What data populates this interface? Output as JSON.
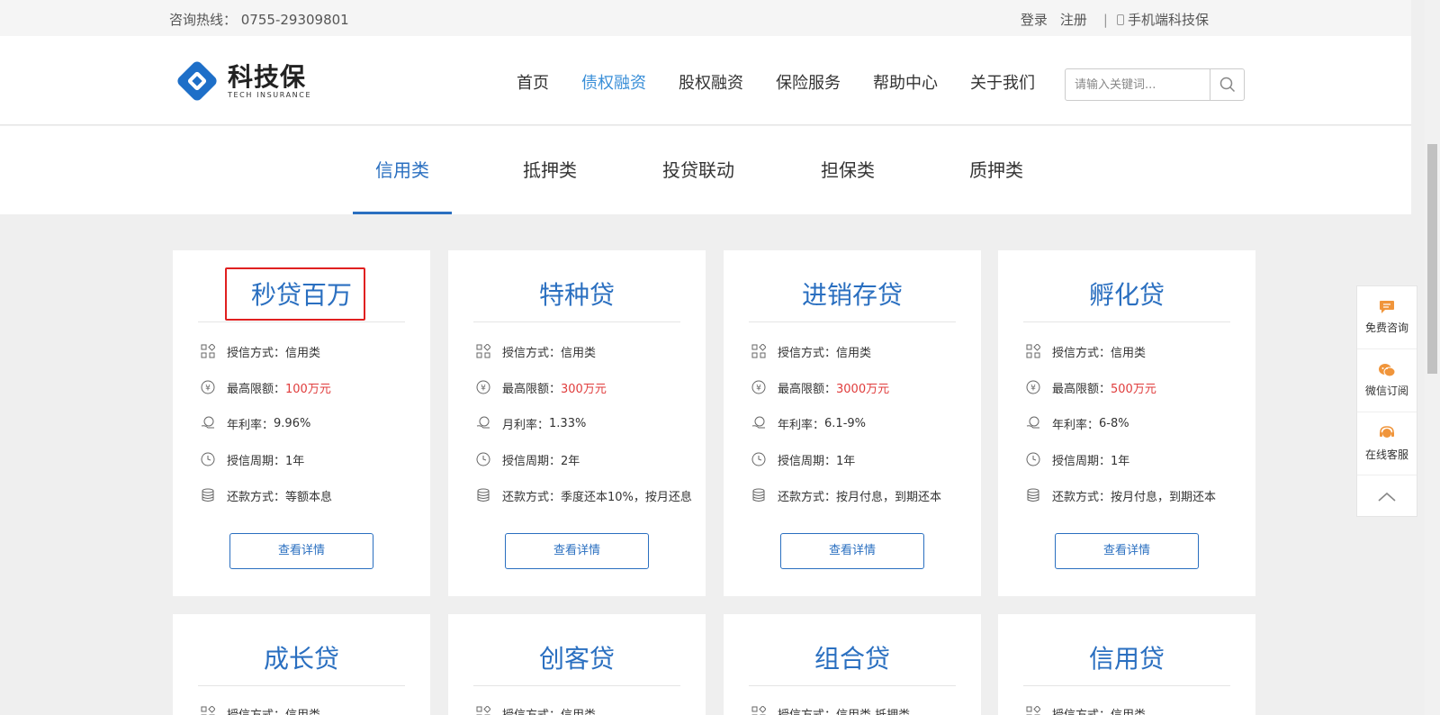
{
  "topbar": {
    "hotline": "咨询热线： 0755-29309801",
    "login": "登录",
    "register": "注册",
    "separator": "|",
    "mobile": "手机端科技保"
  },
  "logo": {
    "cn": "科技保",
    "en": "TECH INSURANCE"
  },
  "nav": {
    "items": [
      "首页",
      "债权融资",
      "股权融资",
      "保险服务",
      "帮助中心",
      "关于我们"
    ],
    "active": "债权融资"
  },
  "search": {
    "placeholder": "请输入关键词..."
  },
  "tabs": {
    "items": [
      "信用类",
      "抵押类",
      "投贷联动",
      "担保类",
      "质押类"
    ],
    "active": "信用类"
  },
  "labels": {
    "method": "授信方式：",
    "limit": "最高限额：",
    "period": "授信周期：",
    "repay": "还款方式：",
    "detail": "查看详情"
  },
  "products": [
    {
      "name": "秒贷百万",
      "method": "信用类",
      "limit": "100万元",
      "rate_label": "年利率：",
      "rate": "9.96%",
      "period": "1年",
      "repay": "等额本息"
    },
    {
      "name": "特种贷",
      "method": "信用类",
      "limit": "300万元",
      "rate_label": "月利率：",
      "rate": "1.33%",
      "period": "2年",
      "repay": "季度还本10%，按月还息"
    },
    {
      "name": "进销存贷",
      "method": "信用类",
      "limit": "3000万元",
      "rate_label": "年利率：",
      "rate": "6.1-9%",
      "period": "1年",
      "repay": "按月付息，到期还本"
    },
    {
      "name": "孵化贷",
      "method": "信用类",
      "limit": "500万元",
      "rate_label": "年利率：",
      "rate": "6-8%",
      "period": "1年",
      "repay": "按月付息，到期还本"
    },
    {
      "name": "成长贷",
      "method": "信用类"
    },
    {
      "name": "创客贷",
      "method": "信用类"
    },
    {
      "name": "组合贷",
      "method": "信用类,抵押类"
    },
    {
      "name": "信用贷",
      "method": "信用类"
    }
  ],
  "float_bar": {
    "consult": "免费咨询",
    "wechat": "微信订阅",
    "service": "在线客服"
  },
  "colors": {
    "accent": "#2a6fc0",
    "nav_active": "#3a8fd8",
    "price": "#e03c3c",
    "float_icon": "#f0953b",
    "highlight": "#e02020"
  }
}
